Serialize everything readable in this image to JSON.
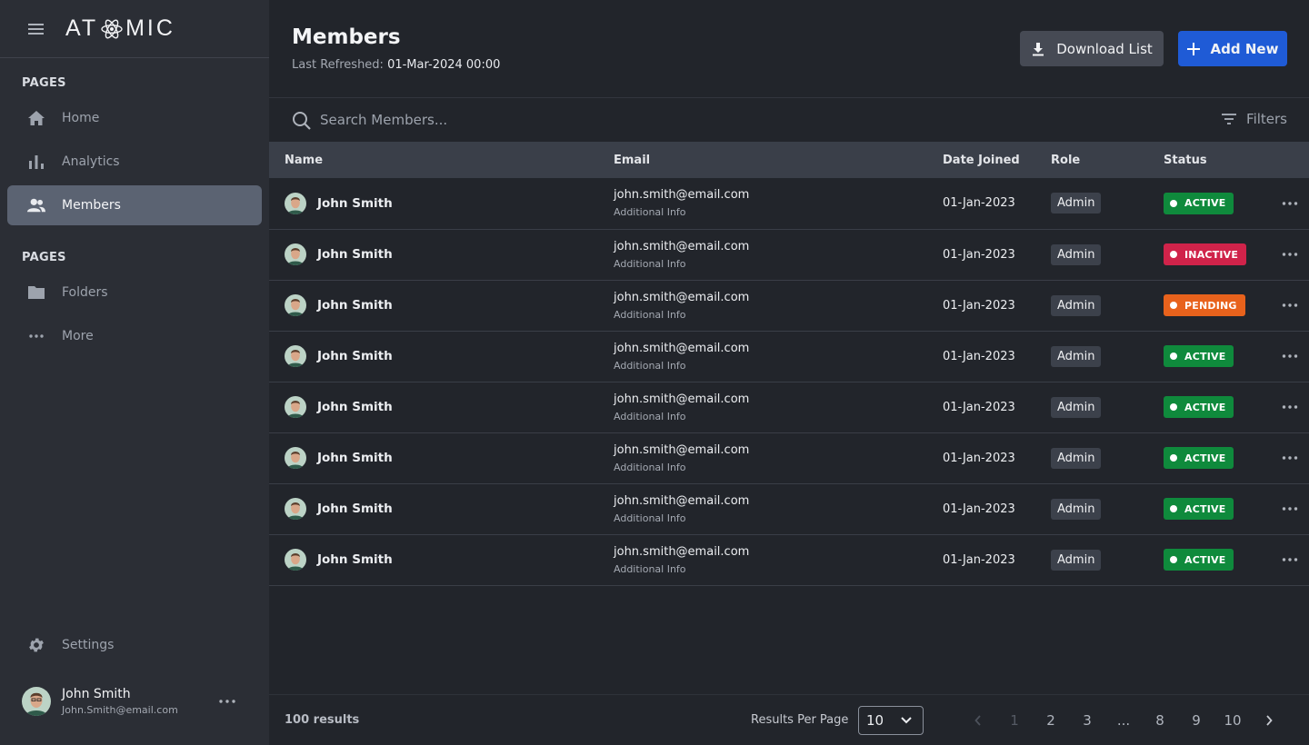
{
  "app": {
    "logo_left": "AT",
    "logo_right": "MIC"
  },
  "sidebar": {
    "section1_title": "PAGES",
    "section2_title": "PAGES",
    "items": [
      {
        "label": "Home",
        "icon": "home-icon"
      },
      {
        "label": "Analytics",
        "icon": "bar-chart-icon"
      },
      {
        "label": "Members",
        "icon": "people-icon"
      },
      {
        "label": "Folders",
        "icon": "folder-icon"
      },
      {
        "label": "More",
        "icon": "more-horizontal-icon"
      }
    ],
    "settings_label": "Settings",
    "user": {
      "name": "John Smith",
      "email": "John.Smith@email.com"
    }
  },
  "header": {
    "title": "Members",
    "refreshed_label": "Last Refreshed:",
    "refreshed_value": "01-Mar-2024 00:00",
    "download_label": "Download List",
    "add_label": "Add New"
  },
  "search": {
    "placeholder": "Search Members...",
    "filters_label": "Filters"
  },
  "table": {
    "columns": [
      "Name",
      "Email",
      "Date Joined",
      "Role",
      "Status"
    ],
    "rows": [
      {
        "name": "John Smith",
        "email": "john.smith@email.com",
        "info": "Additional Info",
        "date": "01-Jan-2023",
        "role": "Admin",
        "status": "ACTIVE"
      },
      {
        "name": "John Smith",
        "email": "john.smith@email.com",
        "info": "Additional Info",
        "date": "01-Jan-2023",
        "role": "Admin",
        "status": "INACTIVE"
      },
      {
        "name": "John Smith",
        "email": "john.smith@email.com",
        "info": "Additional Info",
        "date": "01-Jan-2023",
        "role": "Admin",
        "status": "PENDING"
      },
      {
        "name": "John Smith",
        "email": "john.smith@email.com",
        "info": "Additional Info",
        "date": "01-Jan-2023",
        "role": "Admin",
        "status": "ACTIVE"
      },
      {
        "name": "John Smith",
        "email": "john.smith@email.com",
        "info": "Additional Info",
        "date": "01-Jan-2023",
        "role": "Admin",
        "status": "ACTIVE"
      },
      {
        "name": "John Smith",
        "email": "john.smith@email.com",
        "info": "Additional Info",
        "date": "01-Jan-2023",
        "role": "Admin",
        "status": "ACTIVE"
      },
      {
        "name": "John Smith",
        "email": "john.smith@email.com",
        "info": "Additional Info",
        "date": "01-Jan-2023",
        "role": "Admin",
        "status": "ACTIVE"
      },
      {
        "name": "John Smith",
        "email": "john.smith@email.com",
        "info": "Additional Info",
        "date": "01-Jan-2023",
        "role": "Admin",
        "status": "ACTIVE"
      }
    ]
  },
  "status_colors": {
    "ACTIVE": "#0f8a3c",
    "INACTIVE": "#d0234a",
    "PENDING": "#e8621c"
  },
  "footer": {
    "results": "100 results",
    "rpp_label": "Results Per Page",
    "rpp_value": "10",
    "pages": [
      "1",
      "2",
      "3",
      "...",
      "8",
      "9",
      "10"
    ]
  },
  "colors": {
    "accent": "#1f5bd6",
    "sidebar_bg": "#2b2e35",
    "main_bg": "#22252b"
  }
}
